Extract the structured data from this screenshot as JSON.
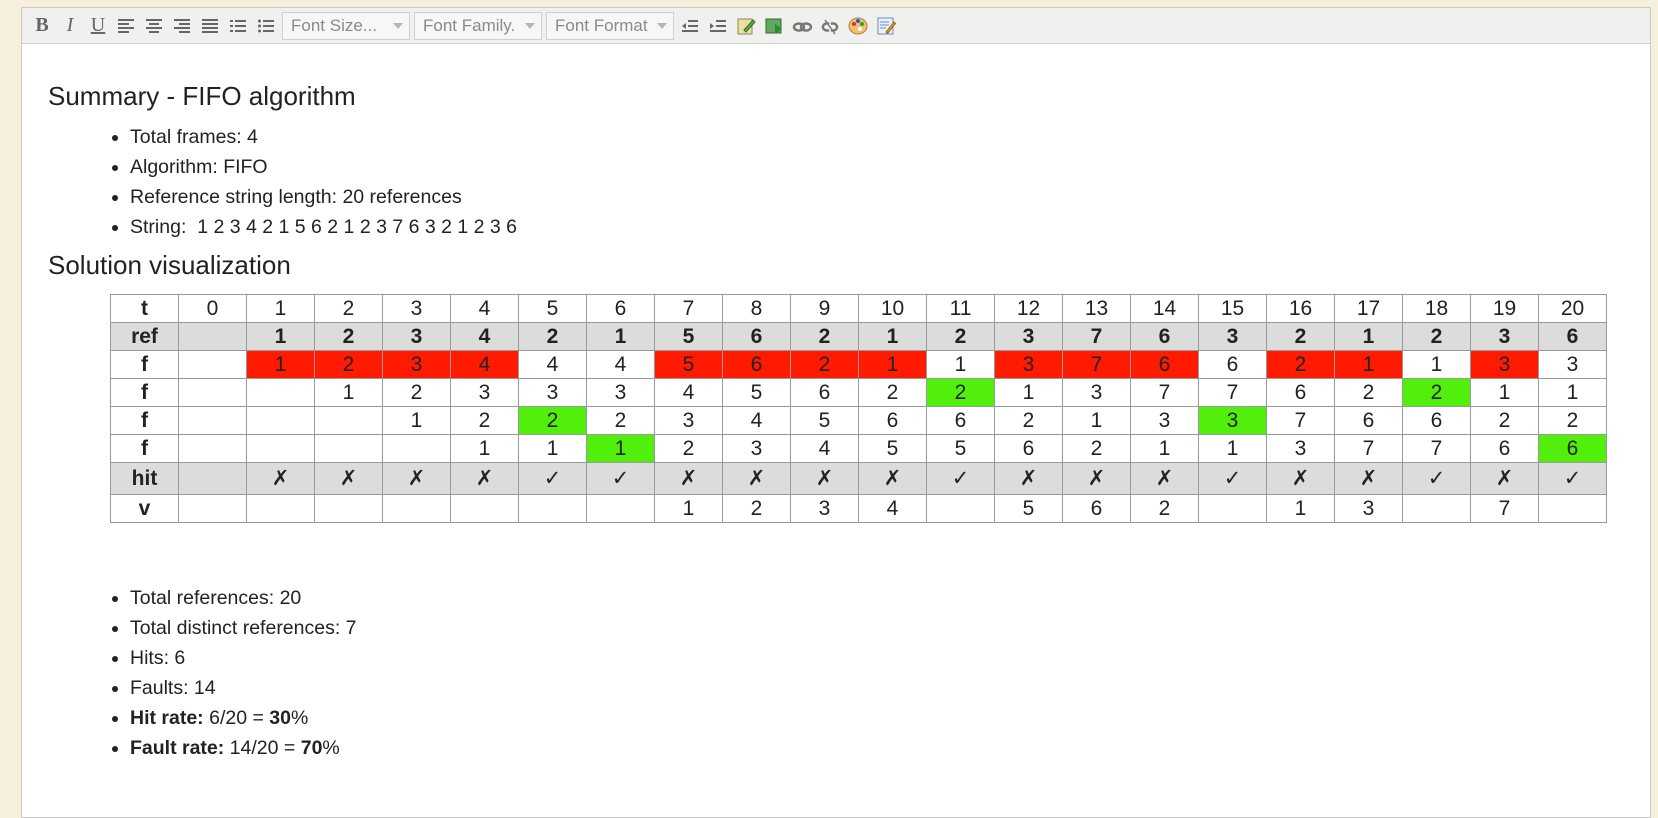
{
  "toolbar": {
    "font_size": "Font Size...",
    "font_family": "Font Family.",
    "font_format": "Font Format"
  },
  "summary": {
    "title": "Summary - FIFO algorithm",
    "items": [
      "Total frames: 4",
      "Algorithm: FIFO",
      "Reference string length:  20 references",
      "String:  1 2 3 4 2 1 5 6 2 1 2 3 7 6 3 2 1 2 3 6"
    ]
  },
  "visualization": {
    "title": "Solution visualization",
    "rows": [
      {
        "label": "t",
        "cells": [
          "0",
          "1",
          "2",
          "3",
          "4",
          "5",
          "6",
          "7",
          "8",
          "9",
          "10",
          "11",
          "12",
          "13",
          "14",
          "15",
          "16",
          "17",
          "18",
          "19",
          "20"
        ]
      },
      {
        "label": "ref",
        "cells": [
          "",
          "1",
          "2",
          "3",
          "4",
          "2",
          "1",
          "5",
          "6",
          "2",
          "1",
          "2",
          "3",
          "7",
          "6",
          "3",
          "2",
          "1",
          "2",
          "3",
          "6"
        ]
      },
      {
        "label": "f",
        "cells": [
          "",
          "1",
          "2",
          "3",
          "4",
          "4",
          "4",
          "5",
          "6",
          "2",
          "1",
          "1",
          "3",
          "7",
          "6",
          "6",
          "2",
          "1",
          "1",
          "3",
          "3"
        ]
      },
      {
        "label": "f",
        "cells": [
          "",
          "",
          "1",
          "2",
          "3",
          "3",
          "3",
          "4",
          "5",
          "6",
          "2",
          "2",
          "1",
          "3",
          "7",
          "7",
          "6",
          "2",
          "2",
          "1",
          "1"
        ]
      },
      {
        "label": "f",
        "cells": [
          "",
          "",
          "",
          "1",
          "2",
          "2",
          "2",
          "3",
          "4",
          "5",
          "6",
          "6",
          "2",
          "1",
          "3",
          "3",
          "7",
          "6",
          "6",
          "2",
          "2"
        ]
      },
      {
        "label": "f",
        "cells": [
          "",
          "",
          "",
          "",
          "1",
          "1",
          "1",
          "2",
          "3",
          "4",
          "5",
          "5",
          "6",
          "2",
          "1",
          "1",
          "3",
          "7",
          "7",
          "6",
          "6"
        ]
      },
      {
        "label": "hit",
        "cells": [
          "",
          "✗",
          "✗",
          "✗",
          "✗",
          "✓",
          "✓",
          "✗",
          "✗",
          "✗",
          "✗",
          "✓",
          "✗",
          "✗",
          "✗",
          "✓",
          "✗",
          "✗",
          "✓",
          "✗",
          "✓"
        ]
      },
      {
        "label": "v",
        "cells": [
          "",
          "",
          "",
          "",
          "",
          "",
          "",
          "1",
          "2",
          "3",
          "4",
          "",
          "5",
          "6",
          "2",
          "",
          "1",
          "3",
          "",
          "7",
          ""
        ]
      }
    ],
    "fault_color": "#ff1a00",
    "hit_color": "#52ee0c"
  },
  "stats": {
    "total_references": "Total references: 20",
    "distinct_references": "Total distinct references: 7",
    "hits": "Hits: 6",
    "faults": "Faults: 14",
    "hit_rate_label": "Hit rate:",
    "hit_rate_expr": " 6/20 = ",
    "hit_rate_value": "30",
    "fault_rate_label": "Fault rate:",
    "fault_rate_expr": " 14/20 = ",
    "fault_rate_value": "70",
    "percent": "%"
  }
}
